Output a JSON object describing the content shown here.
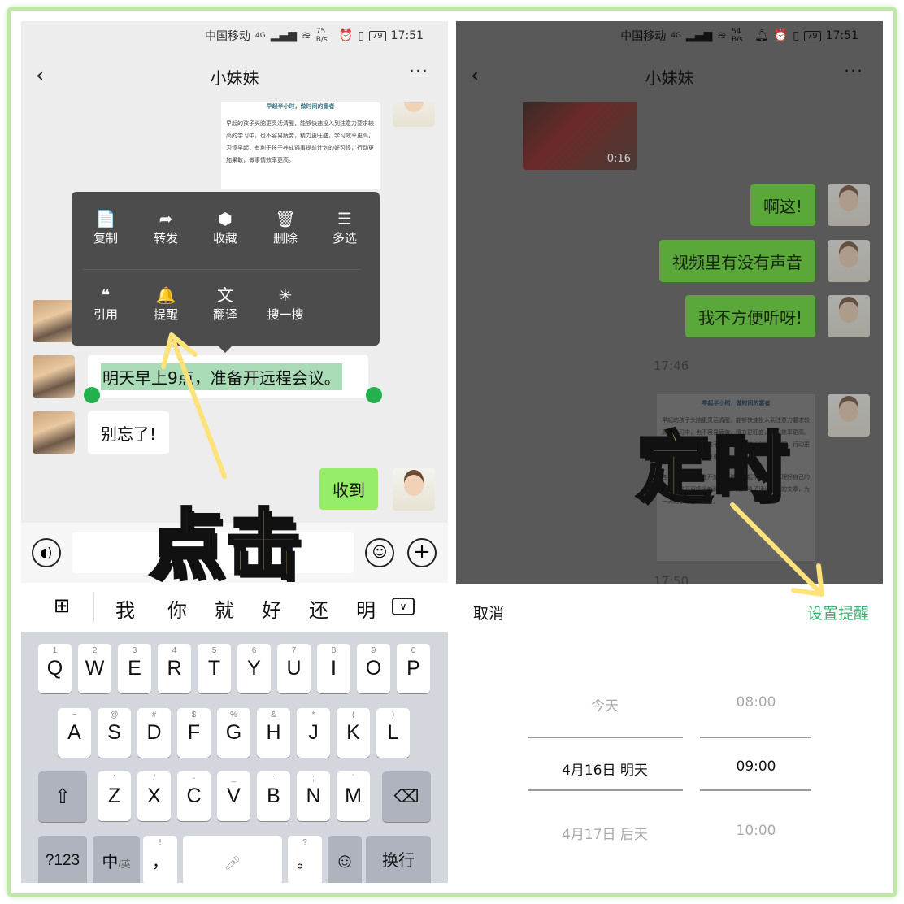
{
  "left": {
    "status": {
      "carrier": "中国移动",
      "network": "4G",
      "speed": "75 B/s",
      "battery": "79",
      "time": "17:51"
    },
    "header": {
      "title": "小妹妹",
      "back": "‹",
      "more": "···"
    },
    "article": {
      "title": "早起半小时，做时间的富者",
      "body": "早起的孩子头脑更灵活清醒，能够快速投入到注意力要求较高的学习中，也不容易疲劳，精力更旺盛，学习效率更高。习惯早起，有利于孩子养成遇事提前计划的好习惯，行动更加果敢，做事情效率更高。"
    },
    "context_menu": {
      "row1": [
        {
          "icon": "📄",
          "label": "复制"
        },
        {
          "icon": "➦",
          "label": "转发"
        },
        {
          "icon": "⬢",
          "label": "收藏"
        },
        {
          "icon": "🗑",
          "label": "删除"
        },
        {
          "icon": "☰",
          "label": "多选"
        }
      ],
      "row2": [
        {
          "icon": "❝",
          "label": "引用"
        },
        {
          "icon": "🔔",
          "label": "提醒"
        },
        {
          "icon": "文",
          "label": "翻译"
        },
        {
          "icon": "✳",
          "label": "搜一搜"
        }
      ]
    },
    "messages": {
      "selected": "明天早上9点，准备开远程会议。",
      "reminder": "别忘了!",
      "reply": "收到"
    },
    "annotation": "点击",
    "candidates": [
      "我",
      "你",
      "就",
      "好",
      "还",
      "明"
    ],
    "keyboard": {
      "row1": [
        [
          "Q",
          "1"
        ],
        [
          "W",
          "2"
        ],
        [
          "E",
          "3"
        ],
        [
          "R",
          "4"
        ],
        [
          "T",
          "5"
        ],
        [
          "Y",
          "6"
        ],
        [
          "U",
          "7"
        ],
        [
          "I",
          "8"
        ],
        [
          "O",
          "9"
        ],
        [
          "P",
          "0"
        ]
      ],
      "row2": [
        [
          "A",
          "~"
        ],
        [
          "S",
          "@"
        ],
        [
          "D",
          "#"
        ],
        [
          "F",
          "$"
        ],
        [
          "G",
          "%"
        ],
        [
          "H",
          "&"
        ],
        [
          "J",
          "*"
        ],
        [
          "K",
          "("
        ],
        [
          "L",
          ")"
        ]
      ],
      "row3": [
        [
          "Z",
          "'"
        ],
        [
          "X",
          "/"
        ],
        [
          "C",
          "-"
        ],
        [
          "V",
          "_"
        ],
        [
          "B",
          ":"
        ],
        [
          "N",
          ";"
        ],
        [
          "M",
          "`"
        ]
      ],
      "num": "?123",
      "lang": "中",
      "lang_sub": "/英",
      "comma": "，",
      "comma_sub": "!",
      "period": "。",
      "period_sub": "?",
      "enter": "换行"
    }
  },
  "right": {
    "status": {
      "carrier": "中国移动",
      "network": "4G",
      "speed": "54 B/s",
      "battery": "79",
      "time": "17:51"
    },
    "header": {
      "title": "小妹妹",
      "back": "‹",
      "more": "···"
    },
    "video_duration": "0:16",
    "messages": [
      "啊这!",
      "视频里有没有声音",
      "我不方便听呀!"
    ],
    "timestamp1": "17:46",
    "article": {
      "title": "早起半小时，做时间的富者",
      "body": "早起的孩子头脑更灵活清醒，能够快速投入到注意力要求较高的学习中，也不容易疲劳，精力更旺盛，学习效率更高。习惯早起，有利于孩子养成遇事提前计划的好习惯，行动更加果敢，做事情效率更高。",
      "body2": "各位家长，从现在开始，让孩子早起半小时，整理好自己的房间，推开窗呼吸新鲜空气，打开嗓子读读想读的文章，为一天的学习蓄满能量。"
    },
    "timestamp2": "17:50",
    "annotation": "定时",
    "sheet": {
      "cancel": "取消",
      "confirm": "设置提醒",
      "accent": "#3cb371",
      "dates": [
        "今天",
        "4月16日 明天",
        "4月17日 后天"
      ],
      "times": [
        "08:00",
        "09:00",
        "10:00"
      ],
      "selected_index": 1
    }
  }
}
